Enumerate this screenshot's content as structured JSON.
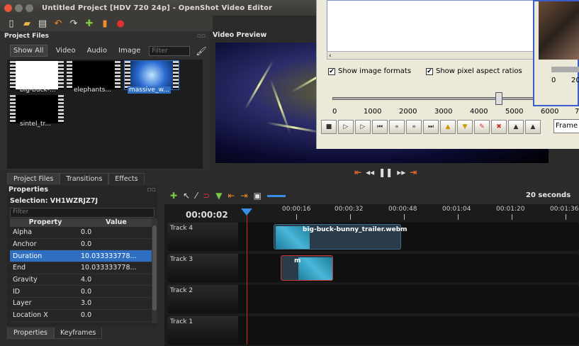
{
  "window": {
    "title": "Untitled Project [HDV 720 24p] - OpenShot Video Editor"
  },
  "project_files": {
    "title": "Project Files",
    "filters": [
      "Show All",
      "Video",
      "Audio",
      "Image"
    ],
    "filter_placeholder": "Filter",
    "files": [
      {
        "label": "big-buck-..."
      },
      {
        "label": "elephants..."
      },
      {
        "label": "massive_w..."
      },
      {
        "label": "sintel_tr..."
      }
    ]
  },
  "panel_tabs": [
    "Project Files",
    "Transitions",
    "Effects"
  ],
  "video_preview": {
    "title": "Video Preview"
  },
  "properties": {
    "title": "Properties",
    "selection": "Selection: VH1WZRJZ7J",
    "filter_placeholder": "Filter",
    "columns": [
      "Property",
      "Value"
    ],
    "rows": [
      {
        "name": "Alpha",
        "value": "0.0"
      },
      {
        "name": "Anchor",
        "value": "0.0"
      },
      {
        "name": "Duration",
        "value": "10.033333778..."
      },
      {
        "name": "End",
        "value": "10.033333778..."
      },
      {
        "name": "Gravity",
        "value": "4.0"
      },
      {
        "name": "ID",
        "value": "0.0"
      },
      {
        "name": "Layer",
        "value": "3.0"
      },
      {
        "name": "Location X",
        "value": "0.0"
      }
    ],
    "tabs": [
      "Properties",
      "Keyframes"
    ]
  },
  "dialog": {
    "checkbox1": "Show image formats",
    "checkbox2": "Show pixel aspect ratios",
    "ruler": [
      "0",
      "1000",
      "2000",
      "3000",
      "4000",
      "5000",
      "6000",
      "7"
    ],
    "frame_select": "Frame"
  },
  "dialog2": {
    "ruler": [
      "0",
      "20"
    ]
  },
  "timeline": {
    "zoom": "20 seconds",
    "timecode": "00:00:02",
    "marks": [
      "00:00:16",
      "00:00:32",
      "00:00:48",
      "00:01:04",
      "00:01:20",
      "00:01:36"
    ],
    "tracks": [
      {
        "name": "Track 4",
        "clip_label": "big-buck-bunny_trailer.webm"
      },
      {
        "name": "Track 3",
        "clip_label": "m"
      },
      {
        "name": "Track 2"
      },
      {
        "name": "Track 1"
      }
    ]
  },
  "colors": {
    "accent": "#2f6fc2",
    "playback": "#ef6a2a",
    "playhead": "#dd2222"
  }
}
